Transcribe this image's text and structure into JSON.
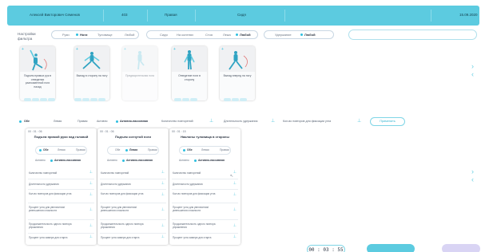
{
  "header": {
    "user_name": "Алексей Викторович Семенов",
    "id": "403",
    "side": "Правая",
    "mode": "Сидя",
    "date": "15.09.2020"
  },
  "filters": {
    "label": "Настройки фильтра",
    "limb_group": {
      "options": [
        "Руки",
        "Ноги",
        "Туловище",
        "Любой"
      ],
      "selected": "Ноги"
    },
    "position_group": {
      "options": [
        "Сидя",
        "На коленях",
        "Стоя",
        "Лежа",
        "Любой"
      ],
      "selected": "Любой"
    },
    "type_group": {
      "options": [
        "Удержание",
        "Любой"
      ],
      "selected": "Любой"
    },
    "search_placeholder": ""
  },
  "exercises": [
    {
      "caption": "Подъем прямых рук в отведении разноименной ноги назад",
      "dim": false
    },
    {
      "caption": "Выпад в сторону на ногу",
      "dim": false
    },
    {
      "caption": "Предварительная нога",
      "dim": true
    },
    {
      "caption": "Отведение ноги в сторону",
      "dim": false
    },
    {
      "caption": "Выпад вперед на ногу",
      "dim": false
    }
  ],
  "controls": {
    "side_options": [
      "Обе",
      "Левая",
      "Правая"
    ],
    "side_selected": "Обе",
    "mode_options": [
      "Активно",
      "Активно-пассивная"
    ],
    "mode_selected": "Активно-пассивная",
    "repeat_label": "Количество повторений",
    "hold_label": "Длительность удержания",
    "fixation_label": "Кол-во повторов для фиксации угла",
    "apply_button": "Применить"
  },
  "panels": [
    {
      "num": "00 : 01 : 06",
      "title": "Подъем прямой руки над головой",
      "side_options": [
        "Обе",
        "Левая",
        "Правая"
      ],
      "side_selected": "Обе",
      "mode_options": [
        "Активно",
        "Активно-пассивная"
      ],
      "mode_selected": "Активно-пассивная",
      "rows": [
        "Количество повторений",
        "Длительность удержания",
        "Кол-во повторов для фиксации угла",
        "Процент угла для увеличения/уменьшения сложности",
        "Продолжительность одного повтора упражнения",
        "Процент угла замера для старта"
      ]
    },
    {
      "num": "00 : 01 : 06",
      "title": "Подъем согнутой ноги",
      "side_options": [
        "Обе",
        "Левая",
        "Правая"
      ],
      "side_selected": "Левая",
      "mode_options": [
        "Активно",
        "Активно-пассивная"
      ],
      "mode_selected": "Активно-пассивная",
      "rows": [
        "Количество повторений",
        "Длительность удержания",
        "Кол-во повторов для фиксации угла",
        "Процент угла для увеличения/уменьшения сложности",
        "Продолжительность одного повтора упражнения",
        "Процент угла замера для старта"
      ]
    },
    {
      "num": "00 : 01 : 15",
      "title": "Наклоны туловища в стороны",
      "side_options": [
        "Обе",
        "Левая",
        "Правая"
      ],
      "side_selected": "Обе",
      "mode_options": [
        "Активно",
        "Активно-пассивная"
      ],
      "mode_selected": "Активно-пассивная",
      "rows": [
        "Количество повторений",
        "Длительность удержания",
        "Кол-во повторов для фиксации угла",
        "Процент угла для увеличения/уменьшения сложности",
        "Продолжительность одного повтора упражнения",
        "Процент угла замера для старта"
      ]
    }
  ],
  "footer": {
    "timer": "00 : 03 : 55"
  },
  "colors": {
    "accent": "#5ccbe0",
    "secondary": "#d9d4f4"
  }
}
